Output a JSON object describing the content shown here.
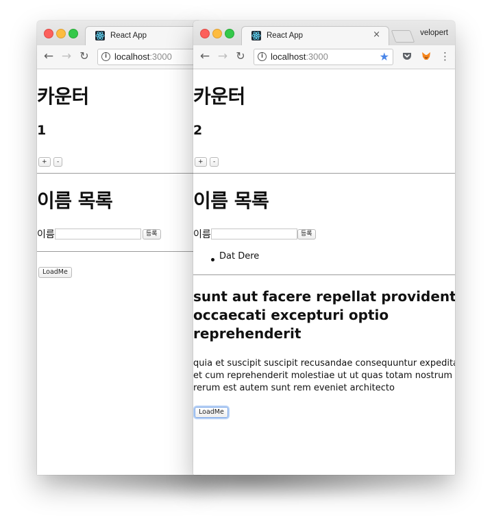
{
  "colors": {
    "traffic_close": "#fc605c",
    "traffic_minimize": "#fdbc40",
    "traffic_maximize": "#34c84a",
    "bookmark_star": "#4a86e8",
    "focus_ring": "#7aa6e8"
  },
  "left_window": {
    "tab_title": "React App",
    "address": {
      "host": "localhost",
      "port": ":3000"
    },
    "counter": {
      "heading": "카운터",
      "value": "1",
      "increment_label": "+",
      "decrement_label": "-"
    },
    "names": {
      "heading": "이름 목록",
      "field_label": "이름",
      "input_value": "",
      "submit_label": "등록",
      "items": []
    },
    "load_button_label": "LoadMe"
  },
  "right_window": {
    "tab_title": "React App",
    "close_tab_glyph": "×",
    "profile_name": "velopert",
    "address": {
      "host": "localhost",
      "port": ":3000"
    },
    "counter": {
      "heading": "카운터",
      "value": "2",
      "increment_label": "+",
      "decrement_label": "-"
    },
    "names": {
      "heading": "이름 목록",
      "field_label": "이름",
      "input_value": "",
      "submit_label": "등록",
      "items": [
        "Dat Dere"
      ]
    },
    "post": {
      "title_lines": [
        "sunt aut facere repellat provident",
        "occaecati excepturi optio",
        "reprehenderit"
      ],
      "body_lines": [
        "quia et suscipit suscipit recusandae consequuntur expedita",
        "et cum reprehenderit molestiae ut ut quas totam nostrum",
        "rerum est autem sunt rem eveniet architecto"
      ]
    },
    "load_button_label": "LoadMe"
  }
}
